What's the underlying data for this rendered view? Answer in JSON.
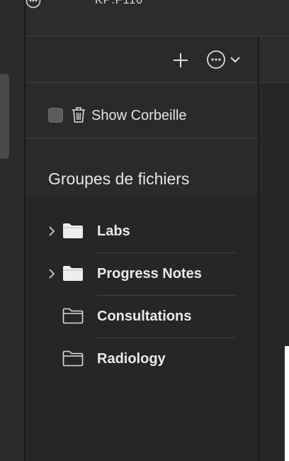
{
  "top_bar": {
    "partial_text": "KP:F110"
  },
  "toolbar": {
    "add_tooltip": "+",
    "more_label": "⋯"
  },
  "options": {
    "show_trash_label": "Show Corbeille",
    "show_trash_checked": false
  },
  "groups": {
    "title": "Groupes de fichiers",
    "items": [
      {
        "label": "Labs",
        "expandable": true,
        "filled": true
      },
      {
        "label": "Progress Notes",
        "expandable": true,
        "filled": true
      },
      {
        "label": "Consultations",
        "expandable": false,
        "filled": false
      },
      {
        "label": "Radiology",
        "expandable": false,
        "filled": false
      }
    ]
  },
  "colors": {
    "background": "#2a2a2a",
    "list_background": "#262626",
    "text": "#e6e6e6",
    "separator": "#444444"
  }
}
